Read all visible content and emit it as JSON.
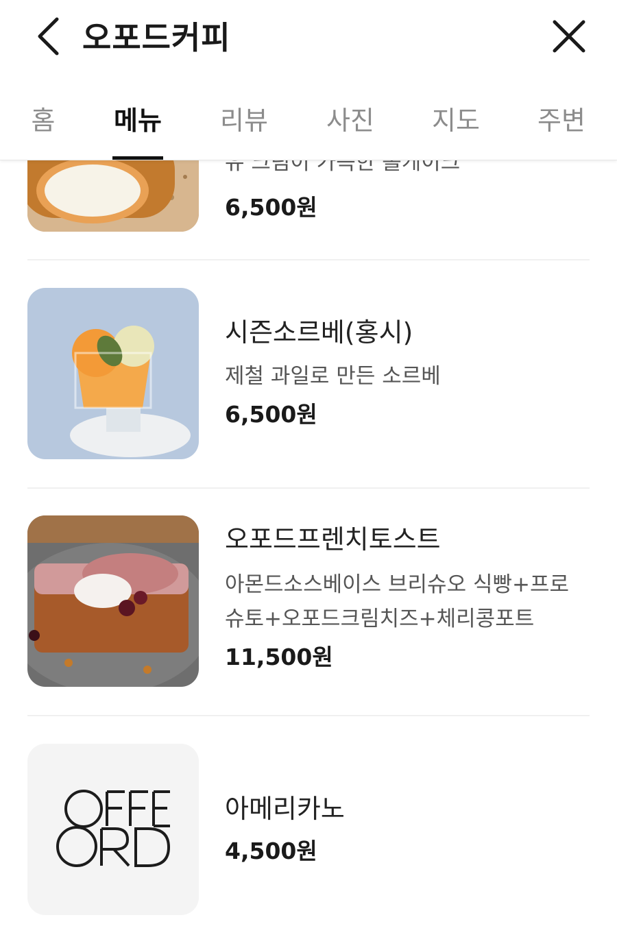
{
  "header": {
    "title": "오포드커피",
    "back_icon": "chevron-left-icon",
    "close_icon": "close-icon"
  },
  "tabs": [
    {
      "label": "홈",
      "active": false
    },
    {
      "label": "메뉴",
      "active": true
    },
    {
      "label": "리뷰",
      "active": false
    },
    {
      "label": "사진",
      "active": false
    },
    {
      "label": "지도",
      "active": false
    },
    {
      "label": "주변",
      "active": false
    }
  ],
  "menu": [
    {
      "name": "",
      "desc": "유 크림이 가득한 롤케이크",
      "price": "6,500원"
    },
    {
      "name": "시즌소르베(홍시)",
      "desc": "제철 과일로 만든 소르베",
      "price": "6,500원"
    },
    {
      "name": "오포드프렌치토스트",
      "desc": "아몬드소스베이스 브리슈오 식빵+프로슈토+오포드크림치즈+체리콩포트",
      "price": "11,500원"
    },
    {
      "name": "아메리카노",
      "desc": "",
      "price": "4,500원"
    }
  ],
  "logo_text": "OFFORD"
}
